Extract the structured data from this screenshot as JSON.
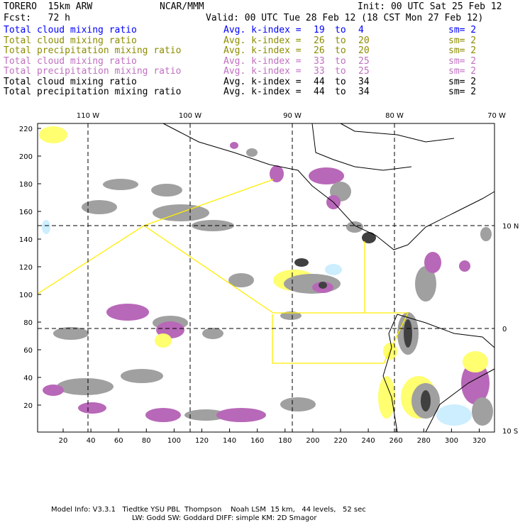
{
  "header": {
    "model": "TORERO  15km ARW",
    "org": "NCAR/MMM",
    "init": "Init: 00 UTC Sat 25 Feb 12",
    "fcst": "Fcst:   72 h",
    "valid": "Valid: 00 UTC Tue 28 Feb 12 (18 CST Mon 27 Feb 12)"
  },
  "legend": [
    {
      "field": "Total cloud mixing ratio",
      "index": "Avg. k-index =",
      "from": "19",
      "to_word": "to",
      "to": "4",
      "sm": "sm= 2",
      "color": "#0000ff"
    },
    {
      "field": "Total cloud mixing ratio",
      "index": "Avg. k-index =",
      "from": "26",
      "to_word": "to",
      "to": "20",
      "sm": "sm= 2",
      "color": "#8c8c00"
    },
    {
      "field": "Total precipitation mixing ratio",
      "index": "Avg. k-index =",
      "from": "26",
      "to_word": "to",
      "to": "20",
      "sm": "sm= 2",
      "color": "#8c8c00"
    },
    {
      "field": "Total cloud mixing ratio",
      "index": "Avg. k-index =",
      "from": "33",
      "to_word": "to",
      "to": "25",
      "sm": "sm= 2",
      "color": "#c070c0"
    },
    {
      "field": "Total precipitation mixing ratio",
      "index": "Avg. k-index =",
      "from": "33",
      "to_word": "to",
      "to": "25",
      "sm": "sm= 2",
      "color": "#c070c0"
    },
    {
      "field": "Total cloud mixing ratio",
      "index": "Avg. k-index =",
      "from": "44",
      "to_word": "to",
      "to": "34",
      "sm": "sm= 2",
      "color": "#000000"
    },
    {
      "field": "Total precipitation mixing ratio",
      "index": "Avg. k-index =",
      "from": "44",
      "to_word": "to",
      "to": "34",
      "sm": "sm= 2",
      "color": "#000000"
    }
  ],
  "map": {
    "top_labels": [
      "110 W",
      "100 W",
      "90 W",
      "80 W",
      "70 W"
    ],
    "right_labels": [
      "10 N",
      "0",
      "10 S"
    ],
    "left_ticks": [
      "220",
      "200",
      "180",
      "160",
      "140",
      "120",
      "100",
      "80",
      "60",
      "40",
      "20"
    ],
    "bottom_ticks": [
      "20",
      "40",
      "60",
      "80",
      "100",
      "120",
      "140",
      "160",
      "180",
      "200",
      "220",
      "240",
      "260",
      "280",
      "300",
      "320"
    ],
    "colors": {
      "gray": "#a0a0a0",
      "dark": "#404040",
      "purple": "#b868b8",
      "yellow": "#ffff70",
      "lightblue": "#cceeff",
      "line": "#ffee00"
    }
  },
  "footer": {
    "line1": "Model Info: V3.3.1   Tiedtke YSU PBL  Thompson    Noah LSM  15 km,   44 levels,   52 sec",
    "line2": "LW: Godd SW: Goddard DIFF: simple KM: 2D Smagor"
  }
}
